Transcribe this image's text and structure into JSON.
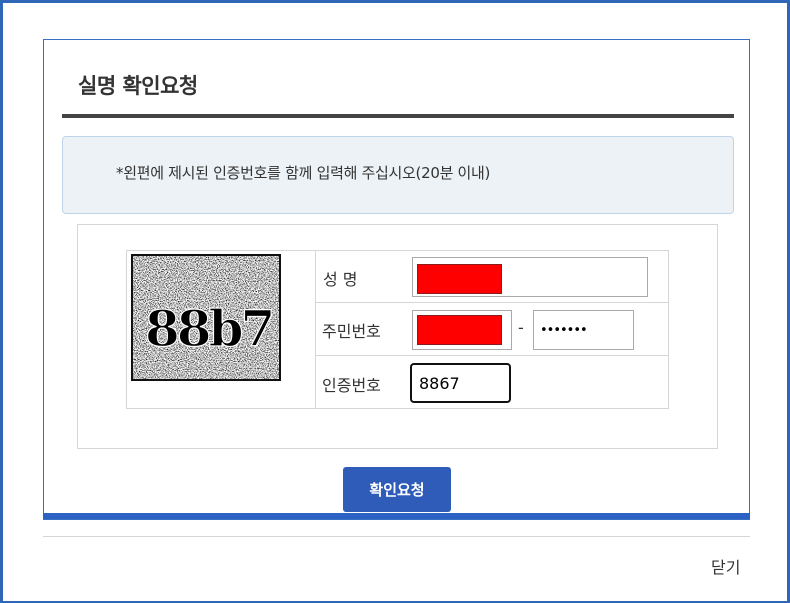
{
  "dialog": {
    "title": "실명 확인요청",
    "notice": "*왼편에 제시된 인증번호를 함께 입력해 주십시오(20분 이내)"
  },
  "captcha": {
    "text": "88b7"
  },
  "form": {
    "name_label": "성 명",
    "rrn_label": "주민번호",
    "rrn_separator": "-",
    "rrn_back_value": "•••••••",
    "code_label": "인증번호",
    "code_value": "8867"
  },
  "buttons": {
    "submit_label": "확인요청",
    "close_label": "닫기"
  },
  "colors": {
    "accent": "#2e5cb8",
    "frame": "#2f66b8",
    "redaction": "#ff0000",
    "notice_bg": "#edf2f6"
  }
}
